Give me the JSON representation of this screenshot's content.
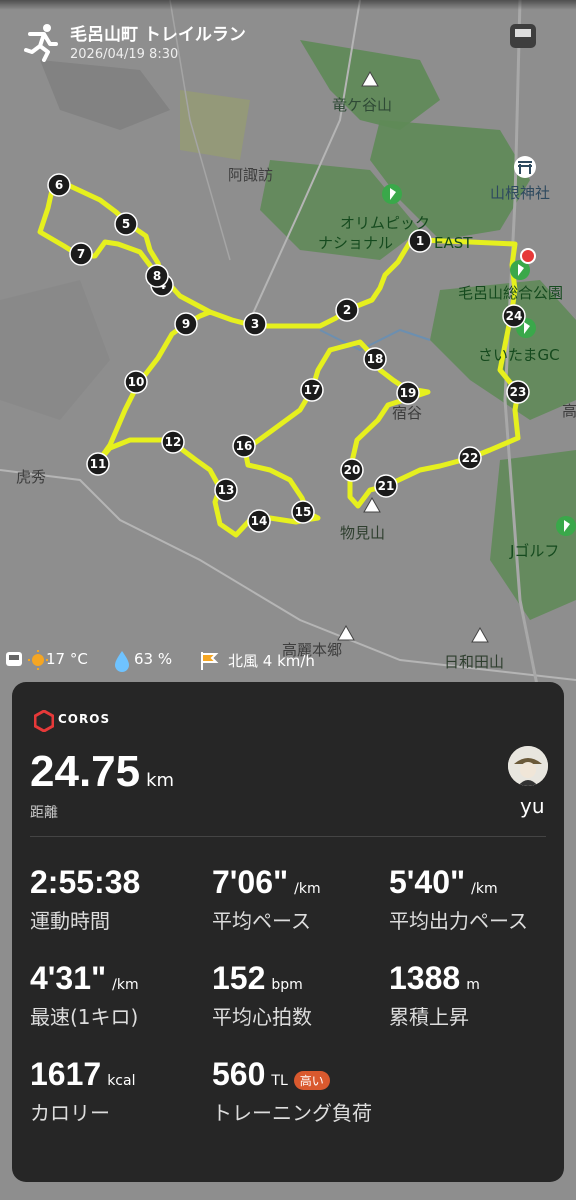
{
  "header": {
    "title": "毛呂山町 トレイルラン",
    "datetime": "2026/04/19 8:30"
  },
  "map": {
    "labels": {
      "ryugaya": "竜ケ谷山",
      "asuwa": "阿諏訪",
      "yamane": "山根神社",
      "olympic1": "オリムピック",
      "olympic2": "ナショナル",
      "east": "EAST",
      "moroyama_park": "毛呂山総合公園",
      "saitama_gc": "さいたまGC",
      "shukuya": "宿谷",
      "tora": "虎秀",
      "monomi": "物見山",
      "j_golf": "Jゴルフ",
      "koma": "高麗本郷",
      "hiwada": "日和田山",
      "taka": "高"
    },
    "markers": [
      "1",
      "2",
      "3",
      "4",
      "5",
      "6",
      "7",
      "8",
      "9",
      "10",
      "11",
      "12",
      "13",
      "14",
      "15",
      "16",
      "17",
      "18",
      "19",
      "20",
      "21",
      "22",
      "23",
      "24"
    ]
  },
  "weather": {
    "temp": "17 °C",
    "humidity": "63 %",
    "wind": "北風 4 km/h"
  },
  "card": {
    "brand": "COROS",
    "distance": "24.75",
    "distance_unit": "km",
    "distance_label": "距離",
    "user": "yu",
    "stats": [
      {
        "value": "2:55:38",
        "unit": "",
        "label": "運動時間"
      },
      {
        "value": "7'06\"",
        "unit": "/km",
        "label": "平均ペース"
      },
      {
        "value": "5'40\"",
        "unit": "/km",
        "label": "平均出力ペース"
      },
      {
        "value": "4'31\"",
        "unit": "/km",
        "label": "最速(1キロ)"
      },
      {
        "value": "152",
        "unit": "bpm",
        "label": "平均心拍数"
      },
      {
        "value": "1388",
        "unit": "m",
        "label": "累積上昇"
      },
      {
        "value": "1617",
        "unit": "kcal",
        "label": "カロリー"
      },
      {
        "value": "560",
        "unit": "TL",
        "label": "トレーニング負荷",
        "badge": "高い"
      }
    ]
  },
  "colors": {
    "route": "#e6f01e",
    "forest": "#5e8a56",
    "base": "#8e8e8e",
    "card": "#262626",
    "badge": "#d9592e"
  }
}
